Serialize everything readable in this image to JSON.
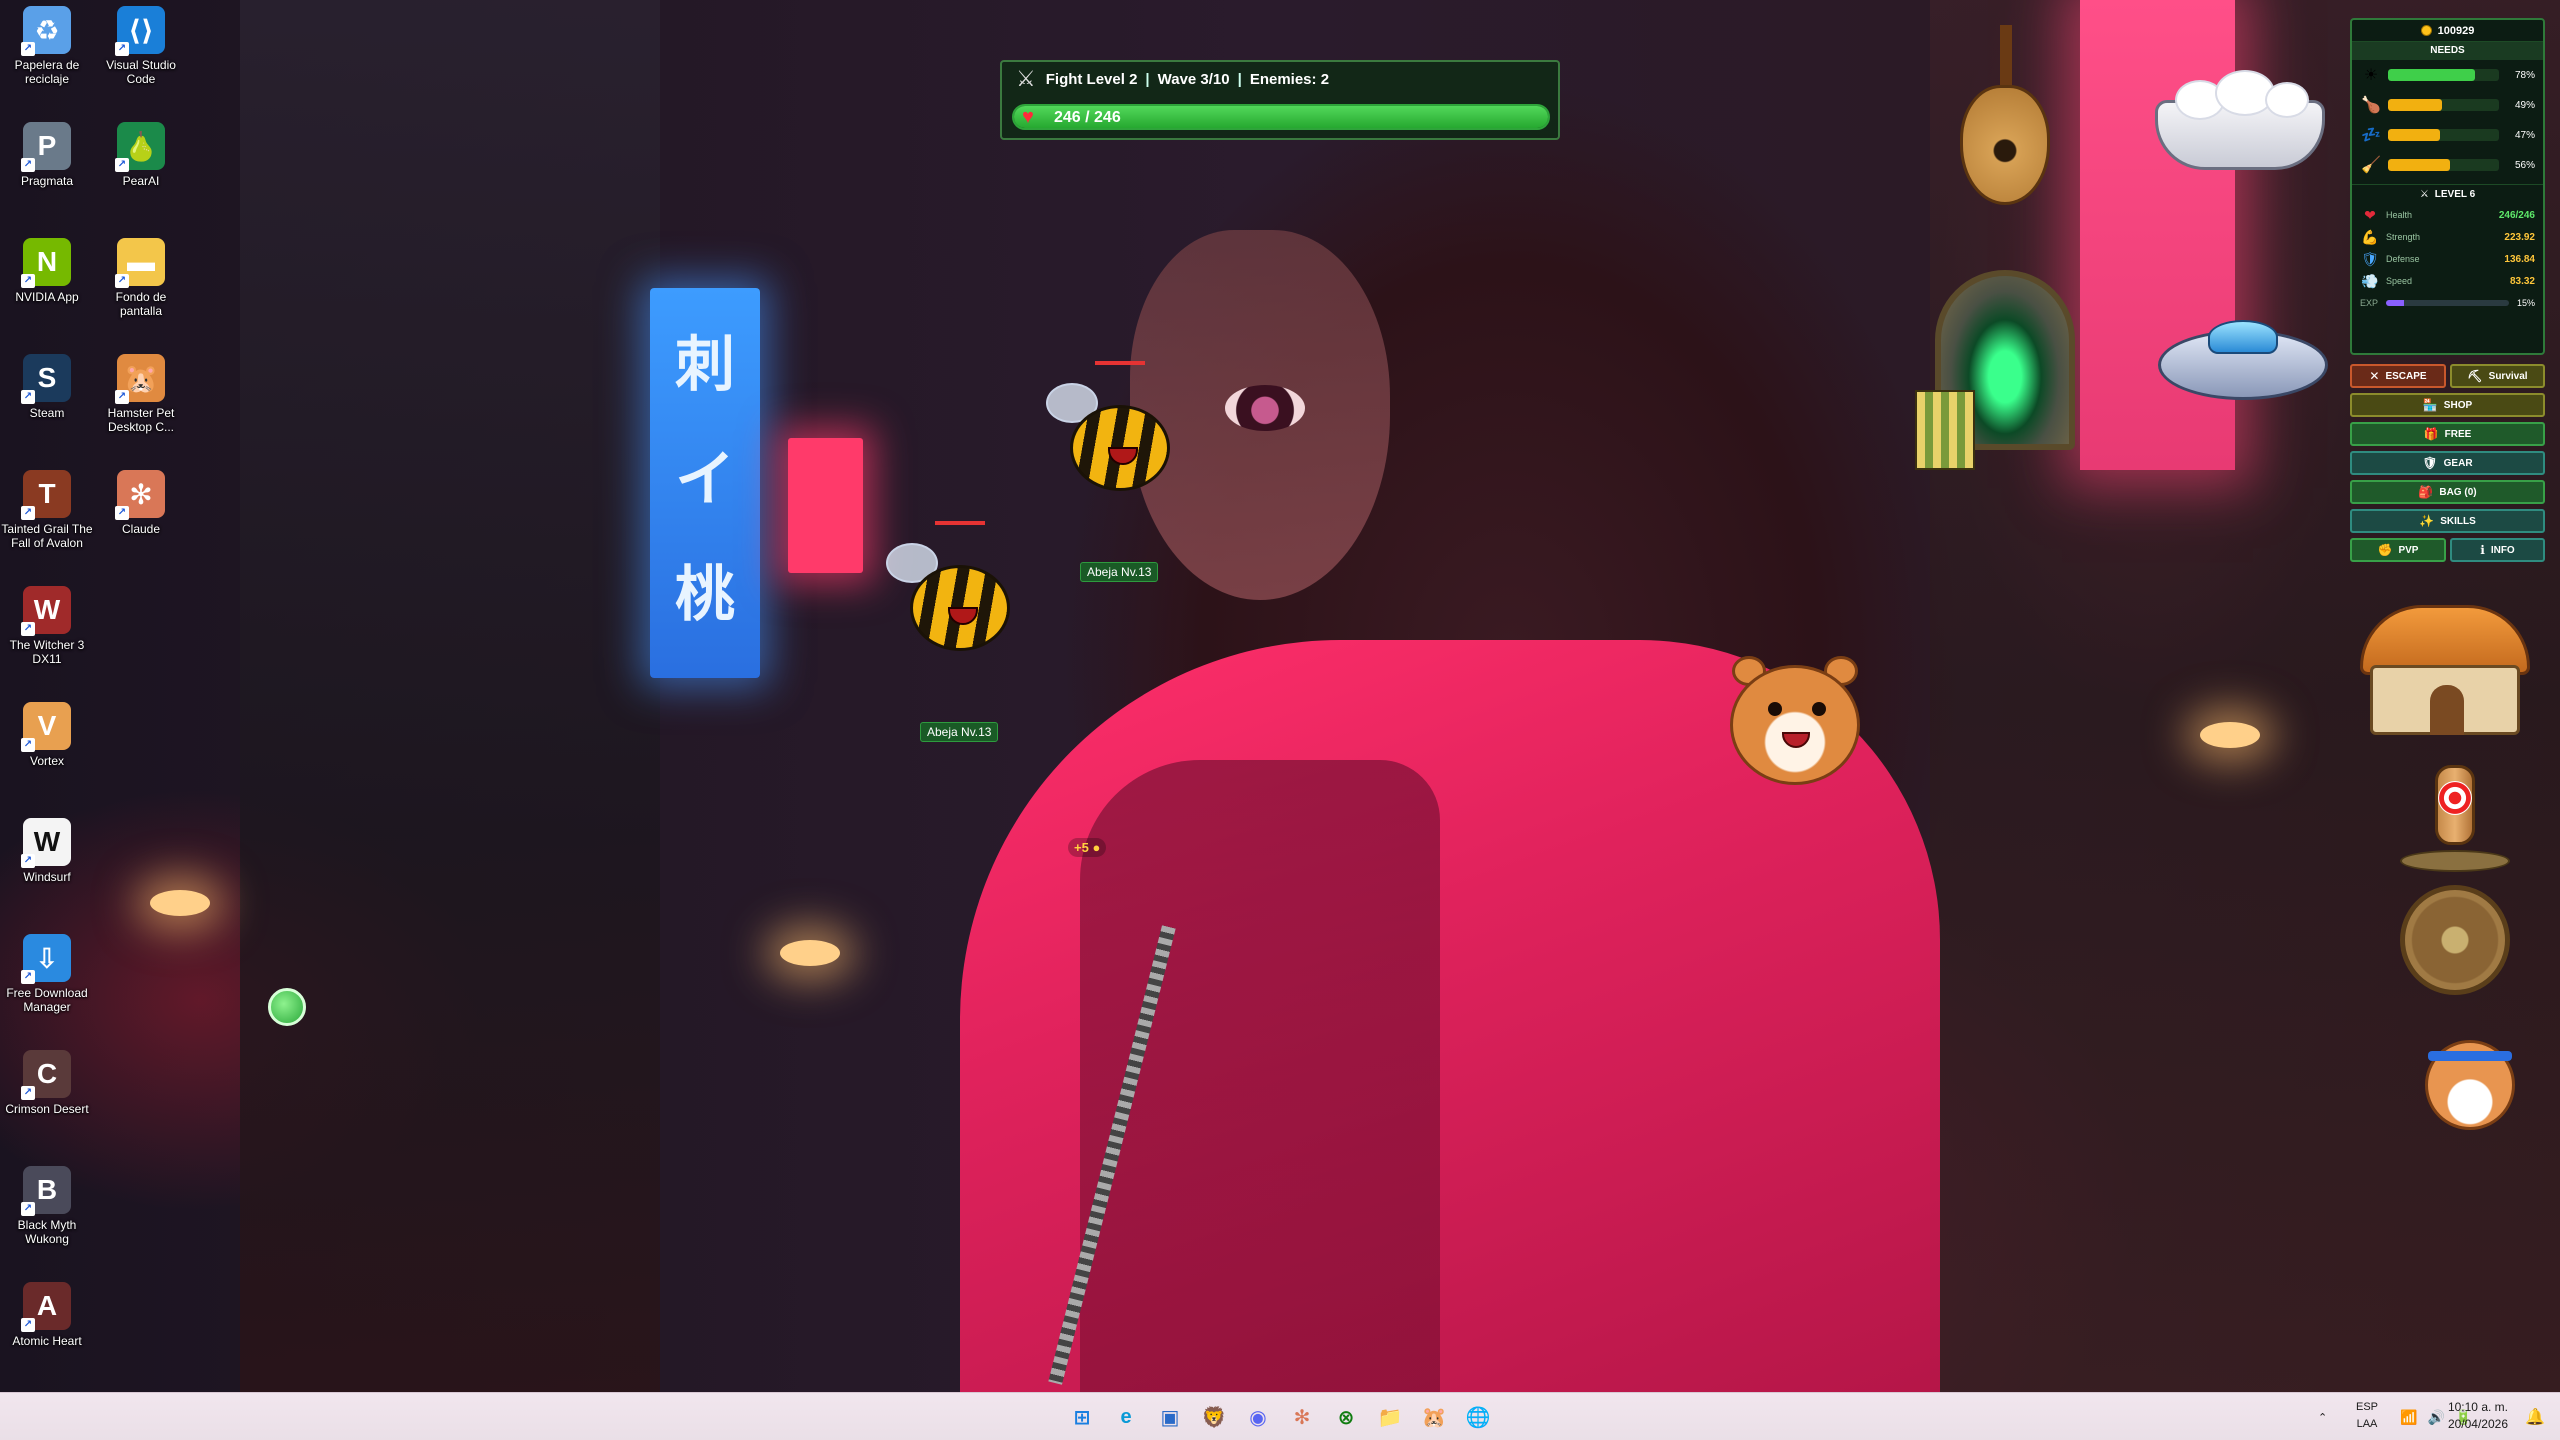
{
  "desktop_icons": [
    {
      "label": "Papelera de reciclaje",
      "icon": "recycle-bin-icon",
      "color": "#5aa0e8",
      "glyph": "♻"
    },
    {
      "label": "Visual Studio Code",
      "icon": "vscode-icon",
      "color": "#1a7fd8",
      "glyph": "⟨⟩"
    },
    {
      "label": "Pragmata",
      "icon": "pragmata-icon",
      "color": "#6a7a8a",
      "glyph": "P"
    },
    {
      "label": "PearAI",
      "icon": "pearai-icon",
      "color": "#1b8a4a",
      "glyph": "🍐"
    },
    {
      "label": "NVIDIA App",
      "icon": "nvidia-icon",
      "color": "#76b900",
      "glyph": "N"
    },
    {
      "label": "Fondo de pantalla",
      "icon": "folder-icon",
      "color": "#f3c64a",
      "glyph": "▬"
    },
    {
      "label": "Steam",
      "icon": "steam-icon",
      "color": "#1b3a5c",
      "glyph": "S"
    },
    {
      "label": "Hamster Pet Desktop C...",
      "icon": "hamster-pet-icon",
      "color": "#e08a40",
      "glyph": "🐹"
    },
    {
      "label": "Tainted Grail The Fall of Avalon",
      "icon": "tainted-grail-icon",
      "color": "#8a3a22",
      "glyph": "T"
    },
    {
      "label": "Claude",
      "icon": "claude-icon",
      "color": "#d97757",
      "glyph": "✻"
    },
    {
      "label": "The Witcher 3 DX11",
      "icon": "witcher-icon",
      "color": "#a02a2a",
      "glyph": "W"
    },
    {
      "label": "Vortex",
      "icon": "vortex-icon",
      "color": "#e8a050",
      "glyph": "V"
    },
    {
      "label": "Windsurf",
      "icon": "windsurf-icon",
      "color": "#f4f4f4",
      "glyph": "W"
    },
    {
      "label": "Free Download Manager",
      "icon": "fdm-icon",
      "color": "#2a8ae0",
      "glyph": "⇩"
    },
    {
      "label": "Crimson Desert",
      "icon": "crimson-desert-icon",
      "color": "#5a3a3a",
      "glyph": "C"
    },
    {
      "label": "Black Myth Wukong",
      "icon": "wukong-icon",
      "color": "#4a4a5a",
      "glyph": "B"
    },
    {
      "label": "Atomic Heart",
      "icon": "atomic-heart-icon",
      "color": "#6a2a2a",
      "glyph": "A"
    }
  ],
  "hud": {
    "fight_level": "Fight Level 2",
    "wave": "Wave 3/10",
    "enemies": "Enemies: 2",
    "hp_text": "246 / 246",
    "hp_fraction": 1.0,
    "bar_color": "#3fcf4a"
  },
  "enemies": [
    {
      "label": "Abeja Nv.13"
    },
    {
      "label": "Abeja Nv.13"
    }
  ],
  "coin_drop": "+5",
  "panel": {
    "coins": "100929",
    "needs_title": "NEEDS",
    "needs": [
      {
        "icon": "sun-icon",
        "glyph": "☀",
        "value": "78%",
        "fraction": 0.78,
        "color": "#3fcf4a"
      },
      {
        "icon": "food-icon",
        "glyph": "🍗",
        "value": "49%",
        "fraction": 0.49,
        "color": "#f2b010"
      },
      {
        "icon": "sleep-icon",
        "glyph": "💤",
        "value": "47%",
        "fraction": 0.47,
        "color": "#f2b010"
      },
      {
        "icon": "clean-icon",
        "glyph": "🧹",
        "value": "56%",
        "fraction": 0.56,
        "color": "#f2b010"
      }
    ],
    "level": "LEVEL 6",
    "stats": [
      {
        "icon": "heart-icon",
        "glyph": "❤",
        "name": "Health",
        "value": "246/246",
        "color": "#e22a3a",
        "val_color": "#5ee86a"
      },
      {
        "icon": "strength-icon",
        "glyph": "💪",
        "name": "Strength",
        "value": "223.92",
        "color": "#ffc63a",
        "val_color": "#ffc63a"
      },
      {
        "icon": "defense-icon",
        "glyph": "🛡",
        "name": "Defense",
        "value": "136.84",
        "color": "#4aa8ff",
        "val_color": "#ffc63a"
      },
      {
        "icon": "speed-icon",
        "glyph": "💨",
        "name": "Speed",
        "value": "83.32",
        "color": "#dddddd",
        "val_color": "#ffc63a"
      }
    ],
    "exp_label": "EXP",
    "exp_value": "15%",
    "exp_fraction": 0.15
  },
  "menu": {
    "escape": "ESCAPE",
    "survival": "Survival",
    "shop": "SHOP",
    "free": "FREE",
    "gear": "GEAR",
    "bag": "BAG (0)",
    "skills": "SKILLS",
    "pvp": "PVP",
    "info": "INFO"
  },
  "taskbar": {
    "apps": [
      {
        "icon": "windows-start-icon",
        "glyph": "⊞",
        "color": "#1a7fe0"
      },
      {
        "icon": "edge-icon",
        "glyph": "e",
        "color": "#0a9ad6"
      },
      {
        "icon": "explorer-window-icon",
        "glyph": "▣",
        "color": "#2a6ac8"
      },
      {
        "icon": "brave-icon",
        "glyph": "🦁",
        "color": "#fb542b"
      },
      {
        "icon": "discord-icon",
        "glyph": "◉",
        "color": "#5865f2"
      },
      {
        "icon": "claude-taskbar-icon",
        "glyph": "✻",
        "color": "#d97757"
      },
      {
        "icon": "xbox-icon",
        "glyph": "⊗",
        "color": "#107c10"
      },
      {
        "icon": "file-explorer-icon",
        "glyph": "📁",
        "color": "#f3b73a"
      },
      {
        "icon": "hamster-taskbar-icon",
        "glyph": "🐹",
        "color": "#e08a40"
      },
      {
        "icon": "globe-app-icon",
        "glyph": "🌐",
        "color": "#2a9ad6"
      }
    ],
    "lang_top": "ESP",
    "lang_bottom": "LAA",
    "time": "10:10 a. m.",
    "date": "20/04/2026"
  }
}
